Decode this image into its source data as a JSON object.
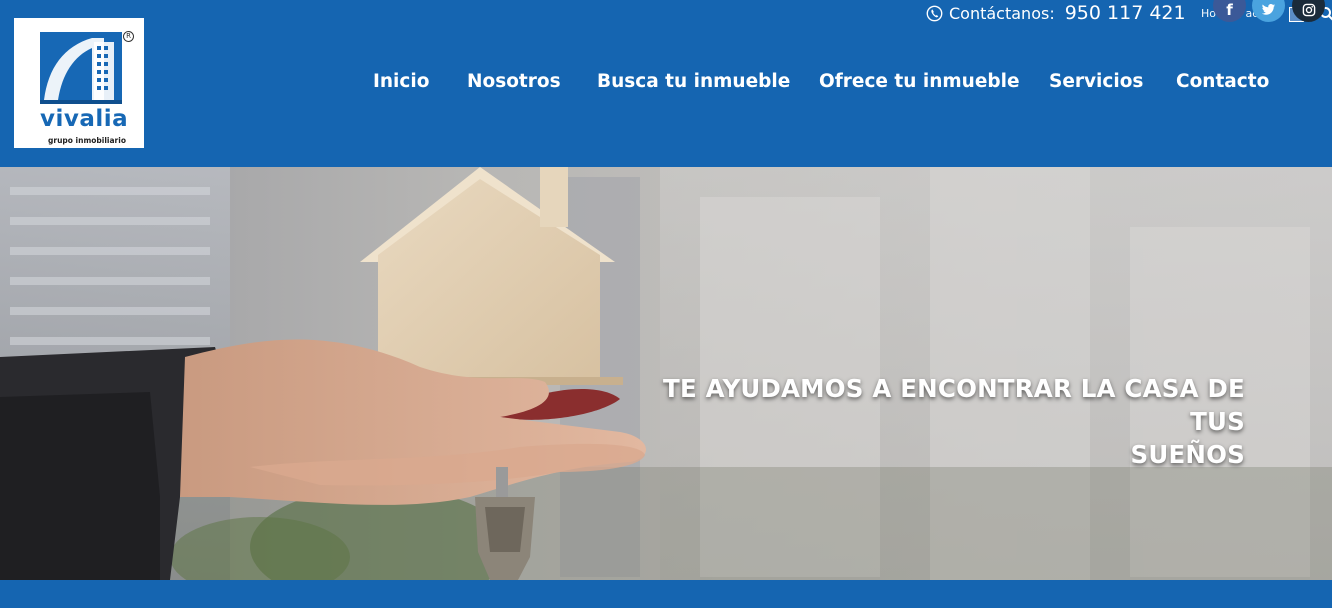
{
  "brand": {
    "name": "vivalia",
    "tagline": "grupo inmobiliario",
    "registered_mark": "R",
    "logo_icon": "building-logo-icon",
    "primary_color": "#1565b1"
  },
  "topbar": {
    "contact_label": "Contáctanos:",
    "phone": "950 117 421",
    "phone_icon": "phone-icon",
    "howdy": "Howdy, admin",
    "search_icon": "search-icon",
    "social": [
      {
        "name": "facebook",
        "glyph": "f",
        "color": "#3b5998"
      },
      {
        "name": "twitter",
        "glyph": "twitter-bird",
        "color": "#4aa3df"
      },
      {
        "name": "instagram",
        "glyph": "instagram-camera",
        "color": "#1b2b3a"
      }
    ]
  },
  "nav": {
    "items": [
      {
        "label": "Inicio"
      },
      {
        "label": "Nosotros"
      },
      {
        "label": "Busca tu inmueble"
      },
      {
        "label": "Ofrece tu inmueble"
      },
      {
        "label": "Servicios"
      },
      {
        "label": "Contacto"
      }
    ]
  },
  "hero": {
    "title_line1": "TE AYUDAMOS A ENCONTRAR LA CASA DE TUS",
    "title_line2": "SUEÑOS"
  }
}
